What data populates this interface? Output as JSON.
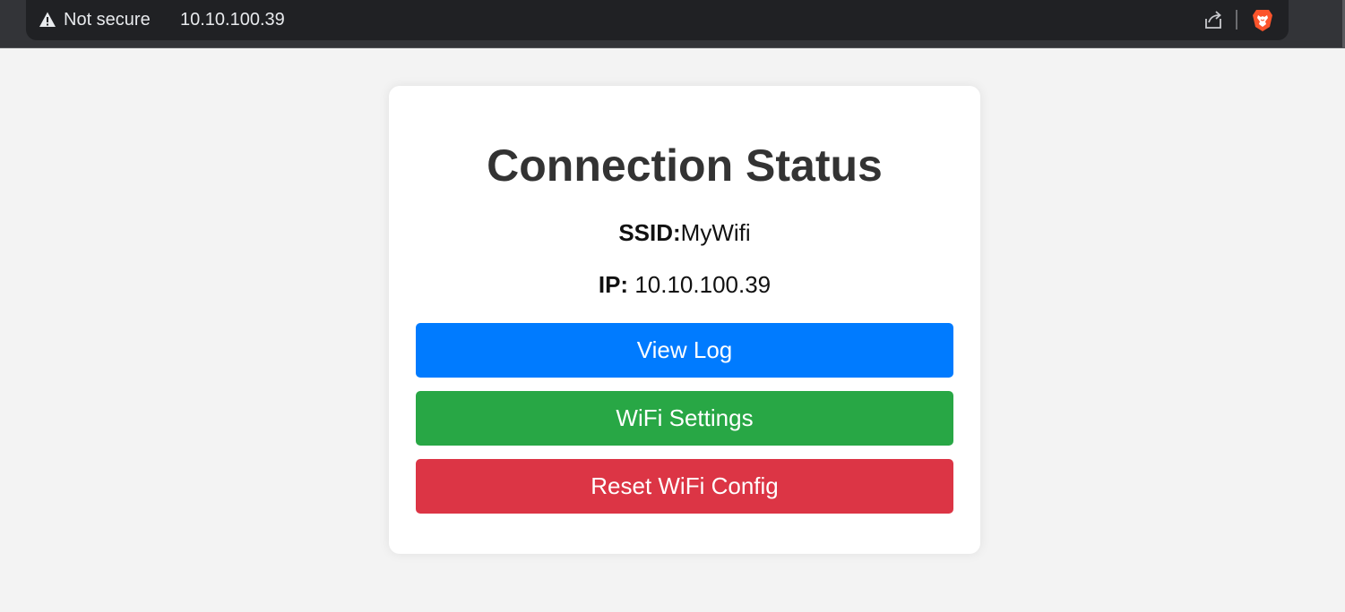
{
  "browser": {
    "security_label": "Not secure",
    "url": "10.10.100.39"
  },
  "status": {
    "title": "Connection Status",
    "ssid_label": "SSID:",
    "ssid_value": "MyWifi",
    "ip_label": "IP:",
    "ip_value": "10.10.100.39"
  },
  "buttons": {
    "view_log": "View Log",
    "wifi_settings": "WiFi Settings",
    "reset_wifi": "Reset WiFi Config"
  },
  "colors": {
    "view_log": "#007bff",
    "wifi_settings": "#28a745",
    "reset_wifi": "#dc3545",
    "page_background": "#f3f3f3",
    "browser_bar": "#333438"
  },
  "icons": {
    "security": "warning-triangle-icon",
    "share": "share-icon",
    "browser": "brave-lion-icon"
  }
}
